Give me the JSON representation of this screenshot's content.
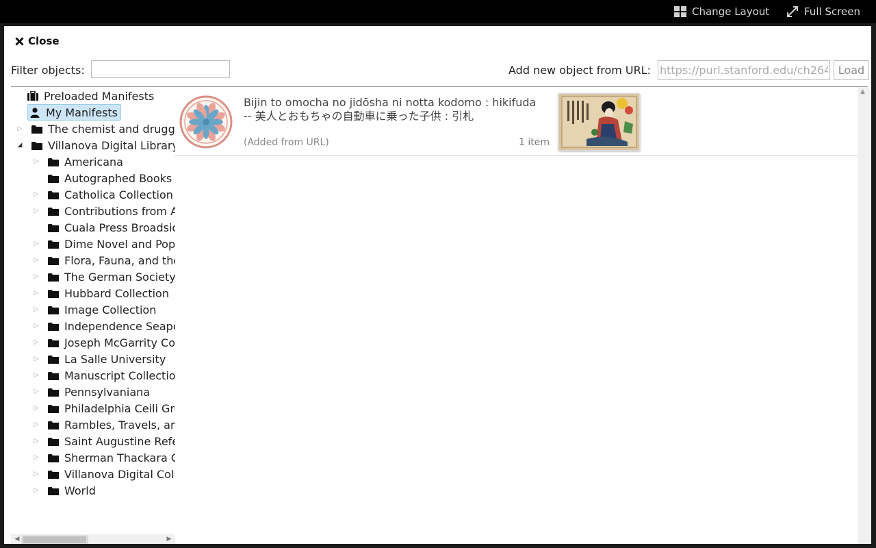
{
  "toolbar": {
    "change_layout_label": "Change Layout",
    "full_screen_label": "Full Screen"
  },
  "dialog": {
    "close_label": "Close",
    "filter_label": "Filter objects:",
    "filter_value": "",
    "add_url_label": "Add new object from URL:",
    "url_value": "https://purl.stanford.edu/ch264",
    "load_label": "Load"
  },
  "tree": {
    "preloaded": "Preloaded Manifests",
    "my_manifests": "My Manifests",
    "chemist": "The chemist and druggi",
    "villanova": "Villanova Digital Library",
    "children": [
      {
        "label": "Americana",
        "expandable": true
      },
      {
        "label": "Autographed Books C",
        "expandable": false
      },
      {
        "label": "Catholica Collection",
        "expandable": true
      },
      {
        "label": "Contributions from A",
        "expandable": true
      },
      {
        "label": "Cuala Press Broadsic",
        "expandable": false
      },
      {
        "label": "Dime Novel and Popu",
        "expandable": true
      },
      {
        "label": "Flora, Fauna, and the",
        "expandable": true
      },
      {
        "label": "The German Society",
        "expandable": true
      },
      {
        "label": "Hubbard Collection",
        "expandable": true
      },
      {
        "label": "Image Collection",
        "expandable": true
      },
      {
        "label": "Independence Seapc",
        "expandable": true
      },
      {
        "label": "Joseph McGarrity Co",
        "expandable": true
      },
      {
        "label": "La Salle University",
        "expandable": true
      },
      {
        "label": "Manuscript Collection",
        "expandable": true
      },
      {
        "label": "Pennsylvaniana",
        "expandable": true
      },
      {
        "label": "Philadelphia Ceili Gro",
        "expandable": true
      },
      {
        "label": "Rambles, Travels, an",
        "expandable": true
      },
      {
        "label": "Saint Augustine Refe",
        "expandable": true
      },
      {
        "label": "Sherman Thackara C",
        "expandable": true
      },
      {
        "label": "Villanova Digital Coll",
        "expandable": true
      },
      {
        "label": "World",
        "expandable": true
      }
    ]
  },
  "manifest": {
    "title_line1": "Bijin to omocha no jidōsha ni notta kodomo : hikifuda",
    "title_line2": "-- 美人とおもちゃの自動車に乗った子供 : 引札",
    "source": "(Added from URL)",
    "count": "1 item"
  },
  "colors": {
    "selected_bg": "#cde6f7",
    "topbar_bg": "#000000"
  }
}
